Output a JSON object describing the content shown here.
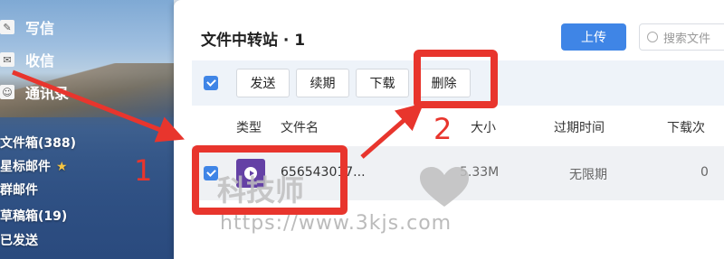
{
  "sidebar": {
    "compose": "写信",
    "inbox": "收信",
    "contacts": "通讯录",
    "folders": [
      {
        "label": "文件箱(388)"
      },
      {
        "label": "星标邮件",
        "star": "★"
      },
      {
        "label": "群邮件"
      },
      {
        "label": "草稿箱(19)"
      },
      {
        "label": "已发送"
      }
    ]
  },
  "panel": {
    "title": "文件中转站 · 1",
    "upload_label": "上传",
    "search_placeholder": "搜索文件"
  },
  "toolbar": {
    "send": "发送",
    "renew": "续期",
    "download": "下载",
    "delete": "删除"
  },
  "columns": {
    "type": "类型",
    "filename": "文件名",
    "size": "大小",
    "expire": "过期时间",
    "downloads": "下载次"
  },
  "file": {
    "name": "656543017...",
    "size": "5.33M",
    "expire": "无限期",
    "downloads": "0",
    "icon": "video-play-icon"
  },
  "annotations": {
    "step1": "1",
    "step2": "2",
    "color": "#e8352d"
  },
  "watermark": {
    "text": "科技师",
    "url": "https://www.3kjs.com"
  }
}
